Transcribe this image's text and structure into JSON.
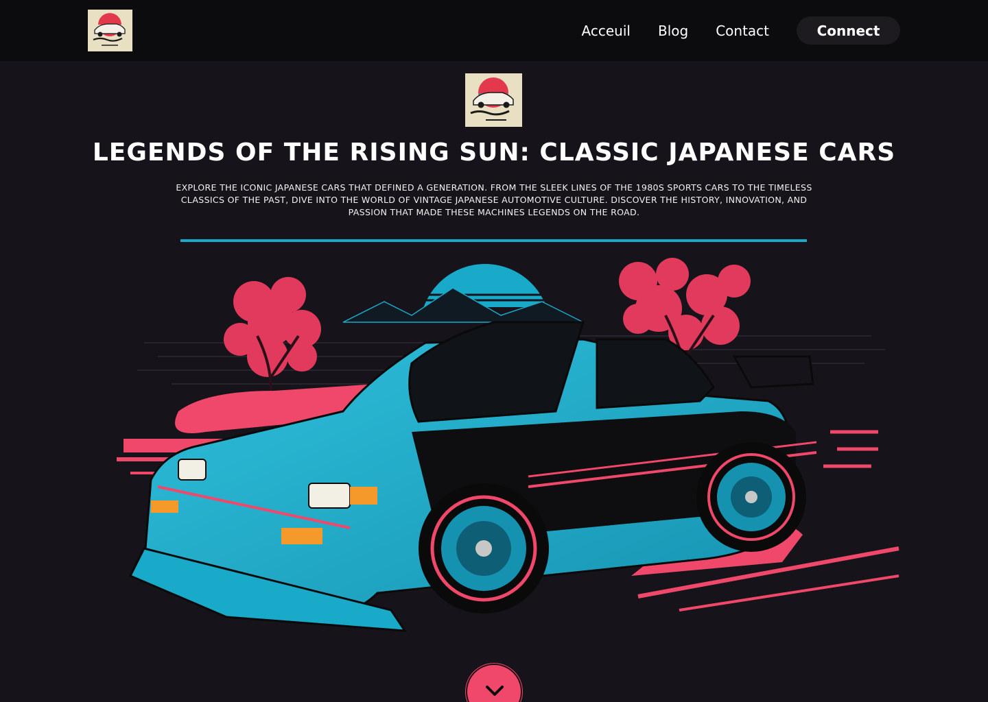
{
  "nav": {
    "logo_icon": "car-club-badge-icon",
    "links": [
      {
        "label": "Acceuil"
      },
      {
        "label": "Blog"
      },
      {
        "label": "Contact"
      }
    ],
    "connect_label": "Connect"
  },
  "hero": {
    "logo_icon": "car-club-badge-icon",
    "title": "LEGENDS OF THE RISING SUN: CLASSIC JAPANESE CARS",
    "description": "EXPLORE THE ICONIC JAPANESE CARS THAT DEFINED A GENERATION. FROM THE SLEEK LINES OF THE 1980S SPORTS CARS TO THE TIMELESS CLASSICS OF THE PAST, DIVE INTO THE WORLD OF VINTAGE JAPANESE AUTOMOTIVE CULTURE. DISCOVER THE HISTORY, INNOVATION, AND PASSION THAT MADE THESE MACHINES LEGENDS ON THE ROAD.",
    "illustration_icon": "retro-car-illustration",
    "scroll_icon": "chevron-down-icon"
  },
  "colors": {
    "background": "#17131a",
    "nav_background": "#0c0b0d",
    "accent_cyan": "#19a9c9",
    "accent_pink": "#f0486a",
    "button_dark": "#1d1b20"
  }
}
